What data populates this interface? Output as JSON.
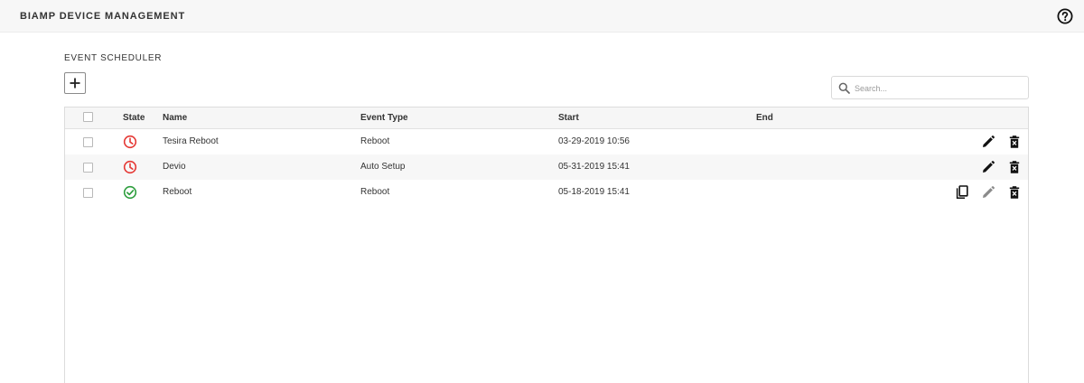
{
  "app": {
    "title": "BIAMP DEVICE MANAGEMENT"
  },
  "header": {
    "help_icon": "help-circle-icon"
  },
  "page": {
    "section_title": "EVENT SCHEDULER"
  },
  "toolbar": {
    "add_icon": "plus-icon"
  },
  "search": {
    "placeholder": "Search...",
    "value": ""
  },
  "table": {
    "columns": [
      "State",
      "Name",
      "Event Type",
      "Start",
      "End"
    ],
    "rows": [
      {
        "state": "scheduled",
        "state_icon": "clock-icon",
        "name": "Tesira Reboot",
        "event_type": "Reboot",
        "start": "03-29-2019 10:56",
        "end": "",
        "actions": [
          "edit-icon",
          "delete-icon"
        ]
      },
      {
        "state": "scheduled",
        "state_icon": "clock-icon",
        "name": "Devio",
        "event_type": "Auto Setup",
        "start": "05-31-2019 15:41",
        "end": "",
        "actions": [
          "edit-icon",
          "delete-icon"
        ]
      },
      {
        "state": "completed",
        "state_icon": "check-circle-icon",
        "name": "Reboot",
        "event_type": "Reboot",
        "start": "05-18-2019 15:41",
        "end": "",
        "actions": [
          "copy-icon",
          "edit-icon",
          "delete-icon"
        ]
      }
    ]
  },
  "colors": {
    "scheduled": "#e53935",
    "completed": "#2e9e3e",
    "action_icon": "#111111",
    "action_icon_disabled": "#8a8a8a",
    "header_bg": "#f7f7f7"
  }
}
